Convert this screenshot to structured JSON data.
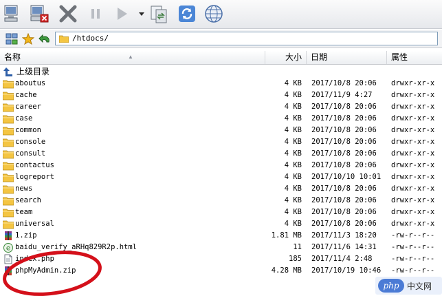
{
  "address": {
    "path": "/htdocs/"
  },
  "columns": {
    "name": "名称",
    "size": "大小",
    "date": "日期",
    "perm": "属性"
  },
  "parent": {
    "label": "上级目录"
  },
  "files": [
    {
      "name": "aboutus",
      "size": "4 KB",
      "date": "2017/10/8 20:06",
      "perm": "drwxr-xr-x",
      "type": "folder"
    },
    {
      "name": "cache",
      "size": "4 KB",
      "date": "2017/11/9 4:27",
      "perm": "drwxr-xr-x",
      "type": "folder"
    },
    {
      "name": "career",
      "size": "4 KB",
      "date": "2017/10/8 20:06",
      "perm": "drwxr-xr-x",
      "type": "folder"
    },
    {
      "name": "case",
      "size": "4 KB",
      "date": "2017/10/8 20:06",
      "perm": "drwxr-xr-x",
      "type": "folder"
    },
    {
      "name": "common",
      "size": "4 KB",
      "date": "2017/10/8 20:06",
      "perm": "drwxr-xr-x",
      "type": "folder"
    },
    {
      "name": "console",
      "size": "4 KB",
      "date": "2017/10/8 20:06",
      "perm": "drwxr-xr-x",
      "type": "folder"
    },
    {
      "name": "consult",
      "size": "4 KB",
      "date": "2017/10/8 20:06",
      "perm": "drwxr-xr-x",
      "type": "folder"
    },
    {
      "name": "contactus",
      "size": "4 KB",
      "date": "2017/10/8 20:06",
      "perm": "drwxr-xr-x",
      "type": "folder"
    },
    {
      "name": "logreport",
      "size": "4 KB",
      "date": "2017/10/10 10:01",
      "perm": "drwxr-xr-x",
      "type": "folder"
    },
    {
      "name": "news",
      "size": "4 KB",
      "date": "2017/10/8 20:06",
      "perm": "drwxr-xr-x",
      "type": "folder"
    },
    {
      "name": "search",
      "size": "4 KB",
      "date": "2017/10/8 20:06",
      "perm": "drwxr-xr-x",
      "type": "folder"
    },
    {
      "name": "team",
      "size": "4 KB",
      "date": "2017/10/8 20:06",
      "perm": "drwxr-xr-x",
      "type": "folder"
    },
    {
      "name": "universal",
      "size": "4 KB",
      "date": "2017/10/8 20:06",
      "perm": "drwxr-xr-x",
      "type": "folder"
    },
    {
      "name": "1.zip",
      "size": "1.81 MB",
      "date": "2017/11/3 18:20",
      "perm": "-rw-r--r--",
      "type": "zip"
    },
    {
      "name": "baidu_verify_aRHq829R2p.html",
      "size": "11",
      "date": "2017/11/6 14:31",
      "perm": "-rw-r--r--",
      "type": "html"
    },
    {
      "name": "index.php",
      "size": "185",
      "date": "2017/11/4 2:48",
      "perm": "-rw-r--r--",
      "type": "php"
    },
    {
      "name": "phpMyAdmin.zip",
      "size": "4.28 MB",
      "date": "2017/10/19 10:46",
      "perm": "-rw-r--r--",
      "type": "zip"
    }
  ],
  "watermark": {
    "logo": "php",
    "text": "中文网"
  },
  "colors": {
    "accent": "#3a6fd8",
    "folder": "#f4c542",
    "highlight": "#d4101a"
  }
}
